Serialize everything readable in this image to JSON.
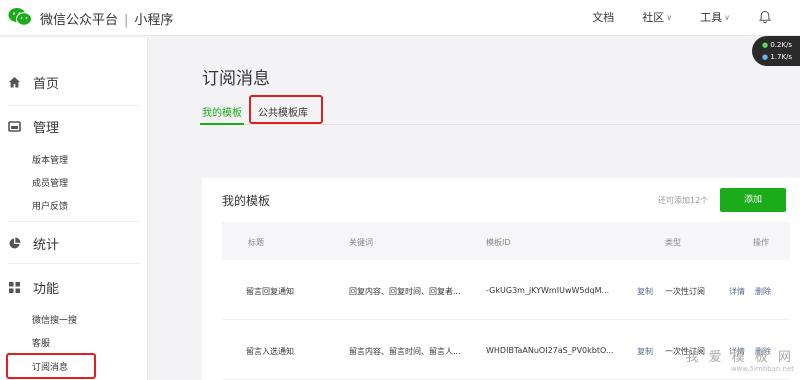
{
  "header": {
    "brand_name": "微信公众平台",
    "brand_separator": "|",
    "brand_product": "小程序",
    "nav": [
      {
        "label": "文档",
        "has_dropdown": false
      },
      {
        "label": "社区",
        "has_dropdown": true
      },
      {
        "label": "工具",
        "has_dropdown": true
      }
    ],
    "bell_icon": "bell-icon",
    "speed": {
      "upload": "0.2",
      "download": "1.7",
      "unit": "K/s"
    }
  },
  "sidebar": {
    "sections": [
      {
        "label": "首页",
        "icon": "home-icon"
      },
      {
        "label": "管理",
        "icon": "manage-icon",
        "items": [
          "版本管理",
          "成员管理",
          "用户反馈"
        ]
      },
      {
        "label": "统计",
        "icon": "chart-pie-icon"
      },
      {
        "label": "功能",
        "icon": "grid-icon",
        "items": [
          "微信搜一搜",
          "客服",
          "订阅消息"
        ]
      }
    ],
    "active_item": "订阅消息"
  },
  "main": {
    "title": "订阅消息",
    "tabs": [
      {
        "label": "我的模板",
        "active": true
      },
      {
        "label": "公共模板库",
        "active": false
      }
    ],
    "card": {
      "title": "我的模板",
      "remaining_text": "还可添加12个",
      "add_button": "添加",
      "columns": [
        "标题",
        "关键词",
        "模板ID",
        "类型",
        "操作"
      ],
      "rows": [
        {
          "title": "留言回复通知",
          "keywords": "回复内容、回复时间、回复者...",
          "template_id": "-GkUG3m_jKYWmIUwW5dqM...",
          "copy": "复制",
          "type": "一次性订阅",
          "detail": "详情",
          "delete": "删除"
        },
        {
          "title": "留言入选通知",
          "keywords": "留言内容、留言时间、留言人...",
          "template_id": "WHDIBTaANuOI27aS_PV0kbtO...",
          "copy": "复制",
          "type": "一次性订阅",
          "detail": "详情",
          "delete": "删除"
        }
      ]
    }
  },
  "watermark": {
    "line1": "我 爱 模 板 网",
    "line2": "www.5imoban.net"
  },
  "colors": {
    "accent": "#1aad19",
    "highlight": "#e02020",
    "link": "#576b95"
  }
}
